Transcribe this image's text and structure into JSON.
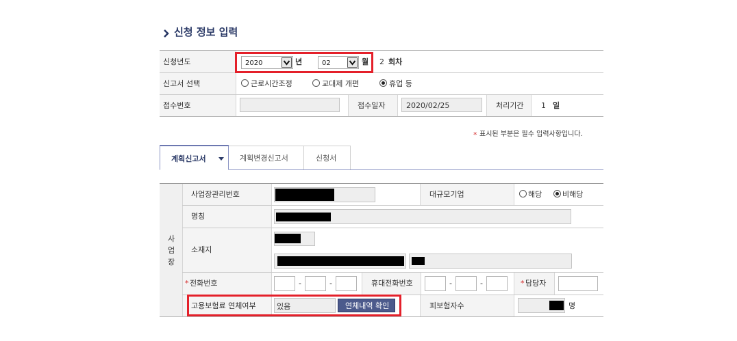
{
  "section": {
    "title": "신청 정보 입력",
    "title_icon": "chevron-right-icon"
  },
  "form_top": {
    "year_label": "신청년도",
    "year_value": "2020",
    "year_unit": "년",
    "month_value": "02",
    "month_unit": "월",
    "round_value": "2",
    "round_unit": "회차",
    "report_label": "신고서 선택",
    "report_options": [
      "근로시간조정",
      "교대제 개편",
      "휴업 등"
    ],
    "report_selected": "휴업 등",
    "receipt_no_label": "접수번호",
    "receipt_no_value": "",
    "receipt_date_label": "접수일자",
    "receipt_date_value": "2020/02/25",
    "period_label": "처리기간",
    "period_value": "1",
    "period_unit": "일"
  },
  "notice": {
    "star": "*",
    "text": "표시된 부분은 필수 입력사항입니다."
  },
  "tabs": [
    {
      "label": "계획신고서",
      "active": true
    },
    {
      "label": "계획변경신고서",
      "active": false
    },
    {
      "label": "신청서",
      "active": false
    }
  ],
  "workplace": {
    "group_label_chars": [
      "사",
      "업",
      "장"
    ],
    "mgmt_no_label": "사업장관리번호",
    "large_company_label": "대규모기업",
    "large_company_options": [
      "해당",
      "비해당"
    ],
    "large_company_selected": "비해당",
    "name_label": "명칭",
    "address_label": "소재지",
    "phone_label": "전화번호",
    "mobile_label": "휴대전화번호",
    "manager_label": "담당자",
    "required_mark": "*",
    "dash": "-",
    "arrears_label": "고용보험료 연체여부",
    "arrears_value": "있음",
    "arrears_button": "연체내역 확인",
    "insured_count_label": "피보험자수",
    "insured_count_unit": "명"
  },
  "colors": {
    "highlight_red": "#e4202a",
    "required_red": "#d42a2a",
    "button_bg": "#4c5a8c",
    "tab_line": "#8a93c3"
  }
}
